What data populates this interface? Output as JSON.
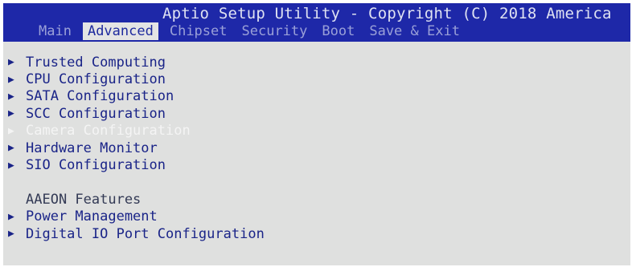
{
  "header": {
    "title": "Aptio Setup Utility - Copyright (C) 2018 America",
    "tabs": [
      "Main",
      "Advanced",
      "Chipset",
      "Security",
      "Boot",
      "Save & Exit"
    ]
  },
  "menu": {
    "items": [
      "Trusted Computing",
      "CPU Configuration",
      "SATA Configuration",
      "SCC Configuration",
      "Camera Configuration",
      "Hardware Monitor",
      "SIO Configuration"
    ],
    "section_heading": "AAEON Features",
    "section_items": [
      "Power Management",
      "Digital IO Port Configuration"
    ]
  },
  "colors": {
    "title_bar": "#1e28a8",
    "body": "#dfe0df",
    "item_text": "#1a2488",
    "selected_text": "#f4f4f4"
  },
  "icons": {
    "submenu": "triangle-right-icon"
  }
}
